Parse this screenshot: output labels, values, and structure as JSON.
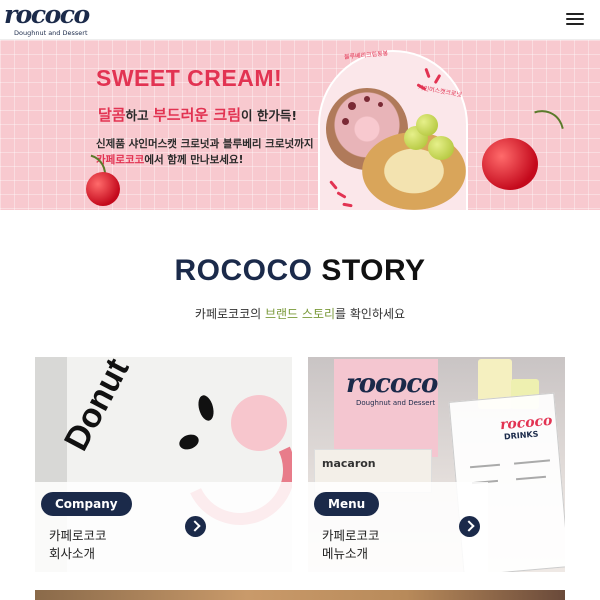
{
  "header": {
    "logo_word": "rococo",
    "logo_tagline": "Doughnut and Dessert",
    "menu_icon": "hamburger-icon"
  },
  "banner": {
    "title": "SWEET CREAM!",
    "sub_pink1": "달콤",
    "sub_text1": "하고 ",
    "sub_pink2": "부드러운 크림",
    "sub_text2": "이 한가득!",
    "desc_line1": "신제품 샤인머스캣 크로넛과 블루베리 크로넛까지",
    "desc2_pink": "카페로코코",
    "desc2_text": "에서 함께 만나보세요!",
    "arch_label1": "블루베리크림봉봉",
    "arch_label2": "샤인머스캣크로넛"
  },
  "story": {
    "title_part1": "ROCOCO",
    "title_part2": "STORY",
    "sub_text1": "카페로코코의 ",
    "sub_green": "브랜드 스토리",
    "sub_text2": "를 확인하세요"
  },
  "cards": [
    {
      "badge": "Company",
      "line1": "카페로코코",
      "line2": "회사소개",
      "art_text": "Donut and"
    },
    {
      "badge": "Menu",
      "line1": "카페로코코",
      "line2": "메뉴소개",
      "logo_word": "rococo",
      "logo_tagline": "Doughnut and Dessert",
      "box_text": "macaron",
      "menu_title": "rococo",
      "menu_subtitle": "DRINKS"
    }
  ],
  "colors": {
    "navy": "#1b2a4a",
    "pink": "#e23352",
    "banner_bg": "#f8c9cf",
    "green": "#7a9a3a"
  }
}
